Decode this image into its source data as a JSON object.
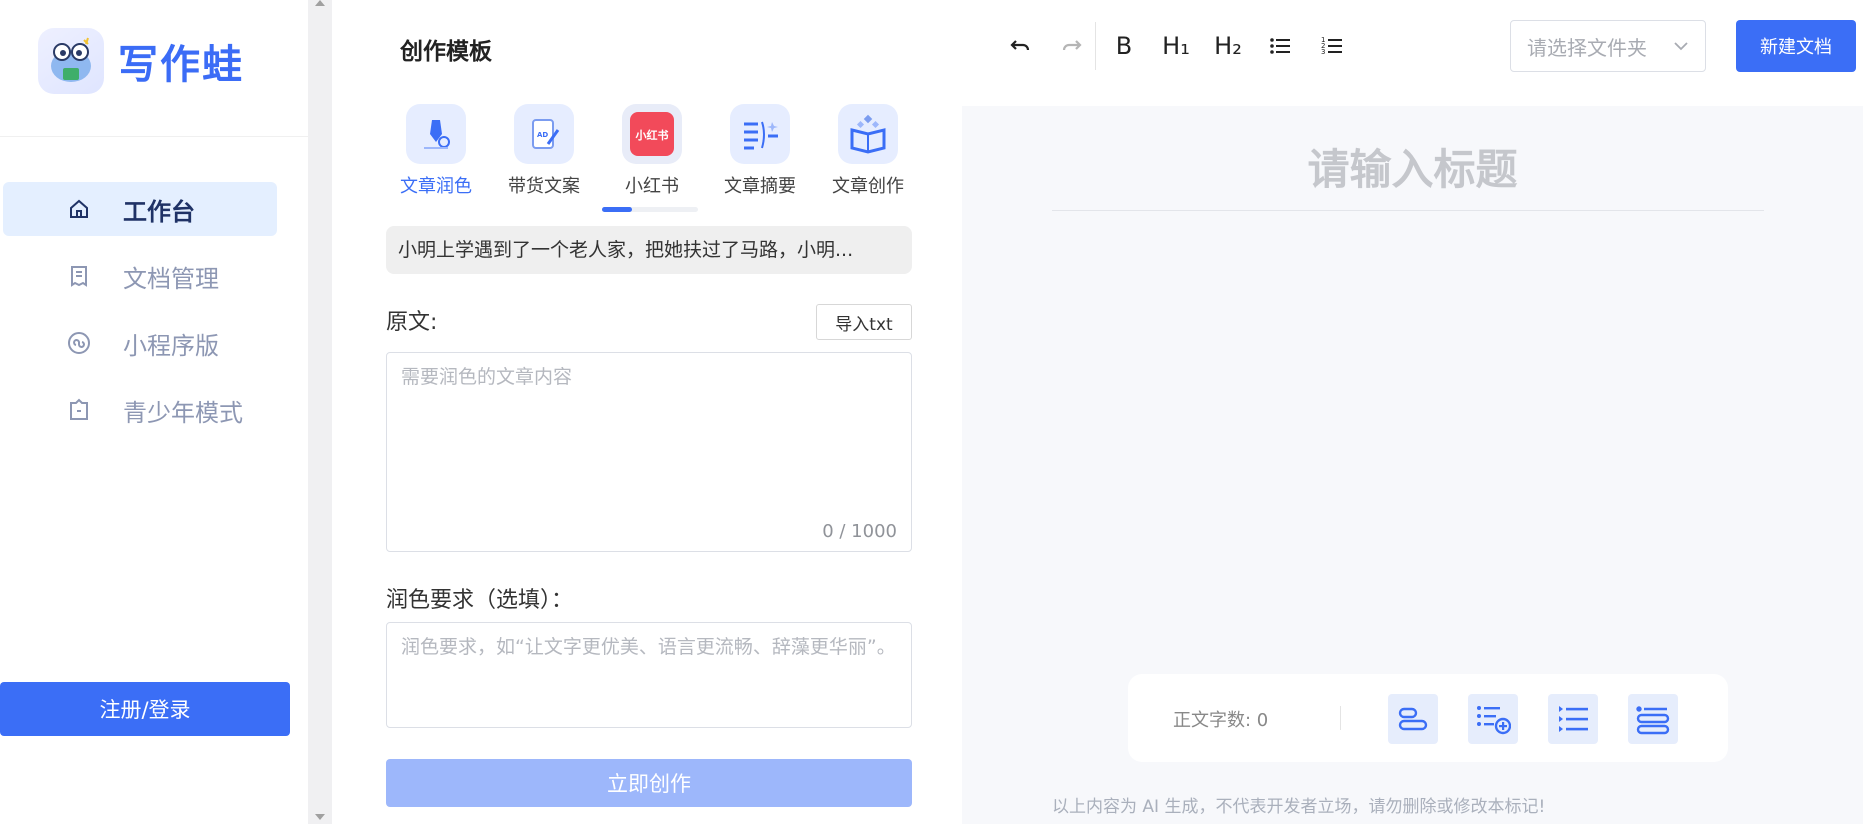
{
  "app": {
    "logo_text": "写作蛙"
  },
  "sidebar": {
    "items": [
      {
        "label": "工作台",
        "icon": "home-icon",
        "active": true
      },
      {
        "label": "文档管理",
        "icon": "document-icon",
        "active": false
      },
      {
        "label": "小程序版",
        "icon": "mini-program-icon",
        "active": false
      },
      {
        "label": "青少年模式",
        "icon": "youth-mode-icon",
        "active": false
      }
    ],
    "login_label": "注册/登录"
  },
  "panel": {
    "title": "创作模板",
    "templates": [
      {
        "label": "文章润色",
        "icon": "pen-polish-icon",
        "active": true
      },
      {
        "label": "带货文案",
        "icon": "ad-copy-icon",
        "active": false
      },
      {
        "label": "小红书",
        "icon": "xiaohongshu-icon",
        "active": false
      },
      {
        "label": "文章摘要",
        "icon": "summary-icon",
        "active": false
      },
      {
        "label": "文章创作",
        "icon": "book-create-icon",
        "active": false
      }
    ],
    "example": "小明上学遇到了一个老人家，把她扶过了马路，小明...",
    "source_label": "原文:",
    "import_label": "导入txt",
    "source_placeholder": "需要润色的文章内容",
    "counter": "0 / 1000",
    "requirement_label": "润色要求（选填）：",
    "requirement_placeholder": "润色要求，如“让文字更优美、语言更流畅、辞藻更华丽”。",
    "create_label": "立即创作"
  },
  "toolbar": {
    "bold": "B",
    "h1": "H₁",
    "h2": "H₂",
    "folder_placeholder": "请选择文件夹",
    "new_doc_label": "新建文档"
  },
  "editor": {
    "title_placeholder": "请输入标题",
    "word_count_label": "正文字数: 0",
    "disclaimer": "以上内容为 AI 生成，不代表开发者立场，请勿删除或修改本标记!"
  },
  "colors": {
    "primary": "#3b6ef6",
    "primary_disabled": "#9db7fb",
    "active_bg": "#e4efff",
    "editor_bg": "#f7f8fb"
  }
}
